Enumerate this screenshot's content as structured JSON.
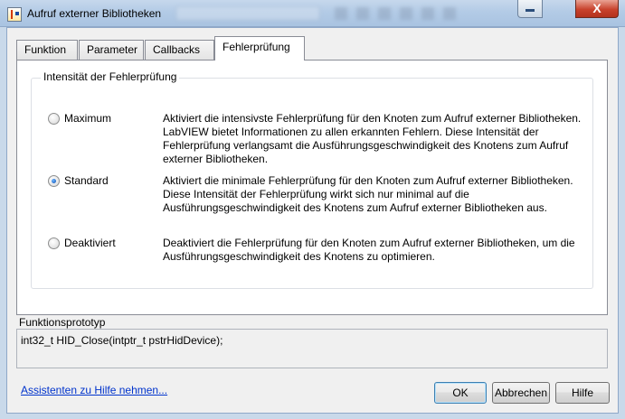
{
  "window": {
    "title": "Aufruf externer Bibliotheken",
    "close_glyph": "X"
  },
  "tabs": [
    {
      "label": "Funktion"
    },
    {
      "label": "Parameter"
    },
    {
      "label": "Callbacks"
    },
    {
      "label": "Fehlerprüfung",
      "active": true
    }
  ],
  "error_checking": {
    "group_title": "Intensität der Fehlerprüfung",
    "options": [
      {
        "label": "Maximum",
        "checked": false,
        "description": "Aktiviert die intensivste Fehlerprüfung für den Knoten zum Aufruf externer Bibliotheken. LabVIEW bietet Informationen zu allen erkannten Fehlern. Diese Intensität der Fehlerprüfung verlangsamt die Ausführungsgeschwindigkeit des Knotens zum Aufruf externer Bibliotheken."
      },
      {
        "label": "Standard",
        "checked": true,
        "description": "Aktiviert die minimale Fehlerprüfung für den Knoten zum Aufruf externer Bibliotheken. Diese Intensität der Fehlerprüfung wirkt sich nur minimal auf die Ausführungsgeschwindigkeit des Knotens zum Aufruf externer Bibliotheken aus."
      },
      {
        "label": "Deaktiviert",
        "checked": false,
        "description": "Deaktiviert die Fehlerprüfung für den Knoten zum Aufruf externer Bibliotheken, um die Ausführungsgeschwindigkeit des Knotens zu optimieren."
      }
    ]
  },
  "prototype": {
    "label": "Funktionsprototyp",
    "value": "int32_t HID_Close(intptr_t pstrHidDevice);"
  },
  "help_link": "Assistenten zu Hilfe nehmen...",
  "buttons": {
    "ok": "OK",
    "cancel": "Abbrechen",
    "help": "Hilfe"
  },
  "colors": {
    "title_bar": "#b3cbe6",
    "close_button": "#c8422c",
    "link": "#0033cc",
    "radio_selected": "#0c4fb3"
  },
  "icons": {
    "app": "labview-app-icon",
    "minimize": "minimize-icon",
    "close": "close-icon"
  }
}
